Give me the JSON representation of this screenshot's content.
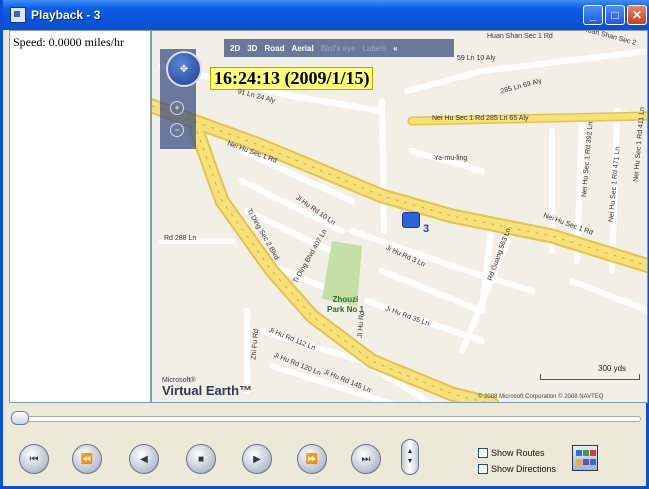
{
  "window": {
    "title": "Playback - 3",
    "icon": "app-icon",
    "buttons": [
      "minimize",
      "maximize",
      "close"
    ]
  },
  "info_panel": {
    "speed_text": "Speed: 0.0000 miles/hr"
  },
  "map": {
    "toolbar": {
      "view_2d": "2D",
      "view_3d": "3D",
      "road": "Road",
      "aerial": "Aerial",
      "bird_eye": "Bird's eye",
      "labels": "Labels",
      "collapse": "«"
    },
    "timestamp": "16:24:13 (2009/1/15)",
    "vehicle_label": "3",
    "logo_small": "Microsoft®",
    "logo_big": "Virtual Earth™",
    "scale_label": "300 yds",
    "copyright": "© 2008 Microsoft Corporation   © 2008 NAVTEQ",
    "street_labels": [
      "Nei Hu Sec 1 Rd",
      "Nei Hu Sec 1 Rd 285 Ln 65 Aly",
      "Huan Shan Sec 1 Rd",
      "Huan Shan Sec 2",
      "59 Ln 10 Aly",
      "285 Ln 69 Aly",
      "91 Ln 24 Aly",
      "Ya-mu-ling",
      "Ji Hu Rd 10 Ln",
      "Rd 288 Ln",
      "Ti Ding Sec 2 Blvd",
      "Ti Ding Blvd 407 Ln",
      "Ji Hu Rd 3 Ln",
      "Rd Guang 563 Ln",
      "Nei Hu Sec 1 Rd",
      "Ji Hu Rd 35 Ln",
      "Ji Hu Rd 112 Ln",
      "Ji Hu Rd 120 Ln",
      "Ji Hu Rd 145 Ln",
      "Ji Hu Rd",
      "Zhi Fu Rd",
      "Nei Hu Sec 1 Rd 411 Ln",
      "Nei Hu Sec 1 Rd 392 Ln",
      "Nei Hu Sec 1 Rd 471 Ln"
    ],
    "park_name_line1": "Zhouzi",
    "park_name_line2": "Park No 1"
  },
  "playback": {
    "position_fraction": 0.0,
    "buttons": [
      "rewind-to-start",
      "previous",
      "step-back",
      "stop",
      "play",
      "next",
      "fast-forward"
    ],
    "show_routes_label": "Show Routes",
    "show_directions_label": "Show Directions",
    "show_routes_checked": false,
    "show_directions_checked": false
  },
  "colors": {
    "titlebar": "#0a5ce6",
    "window_bg": "#ece9d8",
    "main_road": "#f7e27a",
    "map_bg": "#f2efe6",
    "timestamp_bg": "#ffff7a",
    "vehicle": "#2b62d9"
  }
}
